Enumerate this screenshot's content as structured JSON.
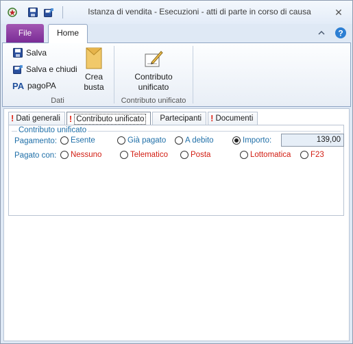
{
  "window": {
    "title": "Istanza di vendita - Esecuzioni - atti di parte in corso di causa",
    "close_label": "✕"
  },
  "ribbon_tabs": {
    "file": "File",
    "home": "Home"
  },
  "ribbon": {
    "dati": {
      "salva": "Salva",
      "salva_e_chiudi": "Salva e chiudi",
      "pagopa": "pagoPA",
      "crea_busta_line1": "Crea",
      "crea_busta_line2": "busta",
      "group_label": "Dati"
    },
    "contributo": {
      "button_line1": "Contributo",
      "button_line2": "unificato",
      "group_label": "Contributo unificato"
    }
  },
  "tabs": [
    {
      "label": "Dati generali",
      "warning": true
    },
    {
      "label": "Contributo unificato",
      "warning": true,
      "active": true
    },
    {
      "label": "Partecipanti",
      "warning": false
    },
    {
      "label": "Documenti",
      "warning": true
    }
  ],
  "warning_mark": "!",
  "form": {
    "group_title": "Contributo unificato",
    "pagamento": {
      "label": "Pagamento:",
      "options": [
        "Esente",
        "Già pagato",
        "A debito",
        "Importo:"
      ],
      "selected": "Importo:",
      "importo_value": "139,00"
    },
    "pagato_con": {
      "label": "Pagato con:",
      "options": [
        "Nessuno",
        "Telematico",
        "Posta",
        "Lottomatica",
        "F23"
      ]
    }
  },
  "colors": {
    "accent": "#1f6fa8",
    "warning": "#e0281a",
    "file_tab": "#8e3ea7"
  }
}
